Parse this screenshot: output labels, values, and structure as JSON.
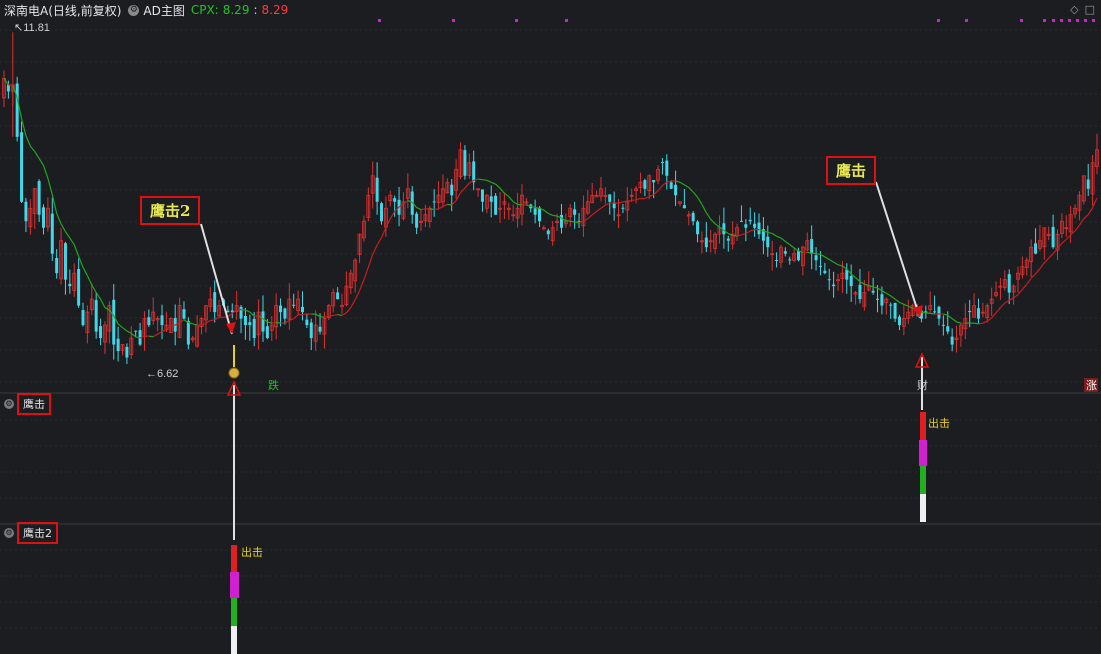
{
  "header": {
    "title": "深南电A(日线,前复权)",
    "indicator": "AD主图",
    "cpx_label": "CPX:",
    "cpx_value_1": "8.29",
    "cpx_value_2": "8.29"
  },
  "top_icons": [
    "diamond-icon",
    "square-icon"
  ],
  "price_high_label": "11.81",
  "price_low_label": "6.62",
  "signal_labels": {
    "die": "跌",
    "cai": "财",
    "zhang": "涨"
  },
  "panels": {
    "p1": {
      "name": "鹰击"
    },
    "p2": {
      "name": "鹰击2"
    }
  },
  "callouts": {
    "left": "鹰击2",
    "right": "鹰击"
  },
  "strike_label": "出击",
  "colors": {
    "background": "#1c1d21",
    "up": "#e03030",
    "down": "#40d8e8",
    "ma_up": "#c81e1e",
    "ma_down": "#1fa81f",
    "callout_border": "#d11",
    "callout_text": "#e8e852",
    "magenta": "#d020d0",
    "green_bar": "#20b020",
    "yellow": "#e8d020"
  },
  "chart_data": {
    "type": "candlestick",
    "ylim": [
      6.3,
      12.0
    ],
    "grid": true,
    "high": 11.81,
    "low": 6.62,
    "closes": [
      11.1,
      10.9,
      11.0,
      10.2,
      9.2,
      8.9,
      9.1,
      9.4,
      9.0,
      8.8,
      9.1,
      8.4,
      8.1,
      8.6,
      8.0,
      7.9,
      8.1,
      7.6,
      7.3,
      7.5,
      7.7,
      7.2,
      7.1,
      7.3,
      7.6,
      7.0,
      6.9,
      7.0,
      6.8,
      7.1,
      7.2,
      7.0,
      7.4,
      7.3,
      7.5,
      7.4,
      7.3,
      7.3,
      7.4,
      7.2,
      7.6,
      7.4,
      7.0,
      7.1,
      7.3,
      7.4,
      7.6,
      7.7,
      7.5,
      7.6,
      7.6,
      7.5,
      7.5,
      7.6,
      7.4,
      7.3,
      7.3,
      7.1,
      7.5,
      7.2,
      7.1,
      7.3,
      7.6,
      7.5,
      7.4,
      7.7,
      7.6,
      7.7,
      7.5,
      7.3,
      7.1,
      7.3,
      7.2,
      7.4,
      7.6,
      7.8,
      7.7,
      7.6,
      7.9,
      8.1,
      8.3,
      8.7,
      8.9,
      9.3,
      9.6,
      9.2,
      8.9,
      9.1,
      9.3,
      9.2,
      9.0,
      9.2,
      9.4,
      9.0,
      8.8,
      8.9,
      9.0,
      9.1,
      9.2,
      9.3,
      9.4,
      9.5,
      9.3,
      9.7,
      10.0,
      9.6,
      9.8,
      9.5,
      9.4,
      9.2,
      9.3,
      9.2,
      9.0,
      9.1,
      9.2,
      9.1,
      9.0,
      9.1,
      9.3,
      9.2,
      9.1,
      9.0,
      8.9,
      8.8,
      8.7,
      8.8,
      8.9,
      8.8,
      8.9,
      9.1,
      9.0,
      8.9,
      9.1,
      9.2,
      9.3,
      9.3,
      9.4,
      9.3,
      9.2,
      9.1,
      9.0,
      9.1,
      9.2,
      9.3,
      9.4,
      9.5,
      9.4,
      9.6,
      9.5,
      9.7,
      9.8,
      9.6,
      9.4,
      9.3,
      9.2,
      9.1,
      9.0,
      8.9,
      8.7,
      8.6,
      8.5,
      8.6,
      8.7,
      8.8,
      8.7,
      8.6,
      8.7,
      8.8,
      8.9,
      8.8,
      8.9,
      8.8,
      8.7,
      8.6,
      8.5,
      8.4,
      8.3,
      8.5,
      8.4,
      8.3,
      8.4,
      8.3,
      8.5,
      8.6,
      8.4,
      8.3,
      8.2,
      8.1,
      8.0,
      7.9,
      8.0,
      8.1,
      8.0,
      7.9,
      7.8,
      7.7,
      7.8,
      7.9,
      7.8,
      7.7,
      7.6,
      7.7,
      7.6,
      7.4,
      7.3,
      7.4,
      7.5,
      7.6,
      7.5,
      7.4,
      7.5,
      7.6,
      7.5,
      7.4,
      7.3,
      7.2,
      7.0,
      7.1,
      7.3,
      7.4,
      7.5,
      7.6,
      7.4,
      7.5,
      7.6,
      7.7,
      7.8,
      7.9,
      8.0,
      7.8,
      7.9,
      8.1,
      8.2,
      8.3,
      8.5,
      8.4,
      8.6,
      8.8,
      8.7,
      8.5,
      8.7,
      8.9,
      8.8,
      9.0,
      9.1,
      9.3,
      9.6,
      9.4,
      9.8,
      10.0
    ]
  }
}
